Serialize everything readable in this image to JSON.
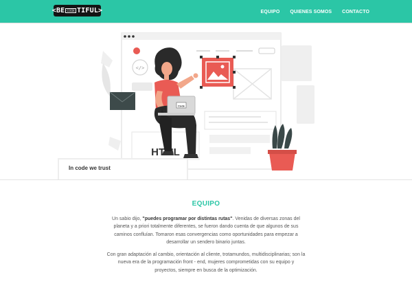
{
  "nav": {
    "logo_left": "<BE",
    "logo_mid": "CODE",
    "logo_right": "TIFUL>",
    "links": [
      "EQUIPO",
      "QUIENES SOMOS",
      "CONTACTO"
    ]
  },
  "hero": {
    "card_text": "In code we trust",
    "laptop_label": "Code",
    "html_label": "HTML",
    "code_icon": "</>"
  },
  "colors": {
    "accent": "#2bc6a6",
    "red": "#e95b54",
    "dark": "#3a3a3a"
  },
  "equipo": {
    "title": "EQUIPO",
    "p1_a": "Un sabio dijo, ",
    "p1_b": "\"puedes programar por distintas rutas\"",
    "p1_c": ". Venidas de diversas zonas del planeta y a priori totalmente diferentes, se fueron dando cuenta de que algunos de sus caminos confluían. Tomaron esas convergencias como oportunidades para empezar a desarrollar un sendero binario juntas.",
    "p2": "Con gran adaptación al cambio, orientación al cliente, trotamundos, multidisciplinarias; son la nueva era de la programación front - end, mujeres comprometidas con su equipo y proyectos, siempre en busca de la optimización."
  }
}
